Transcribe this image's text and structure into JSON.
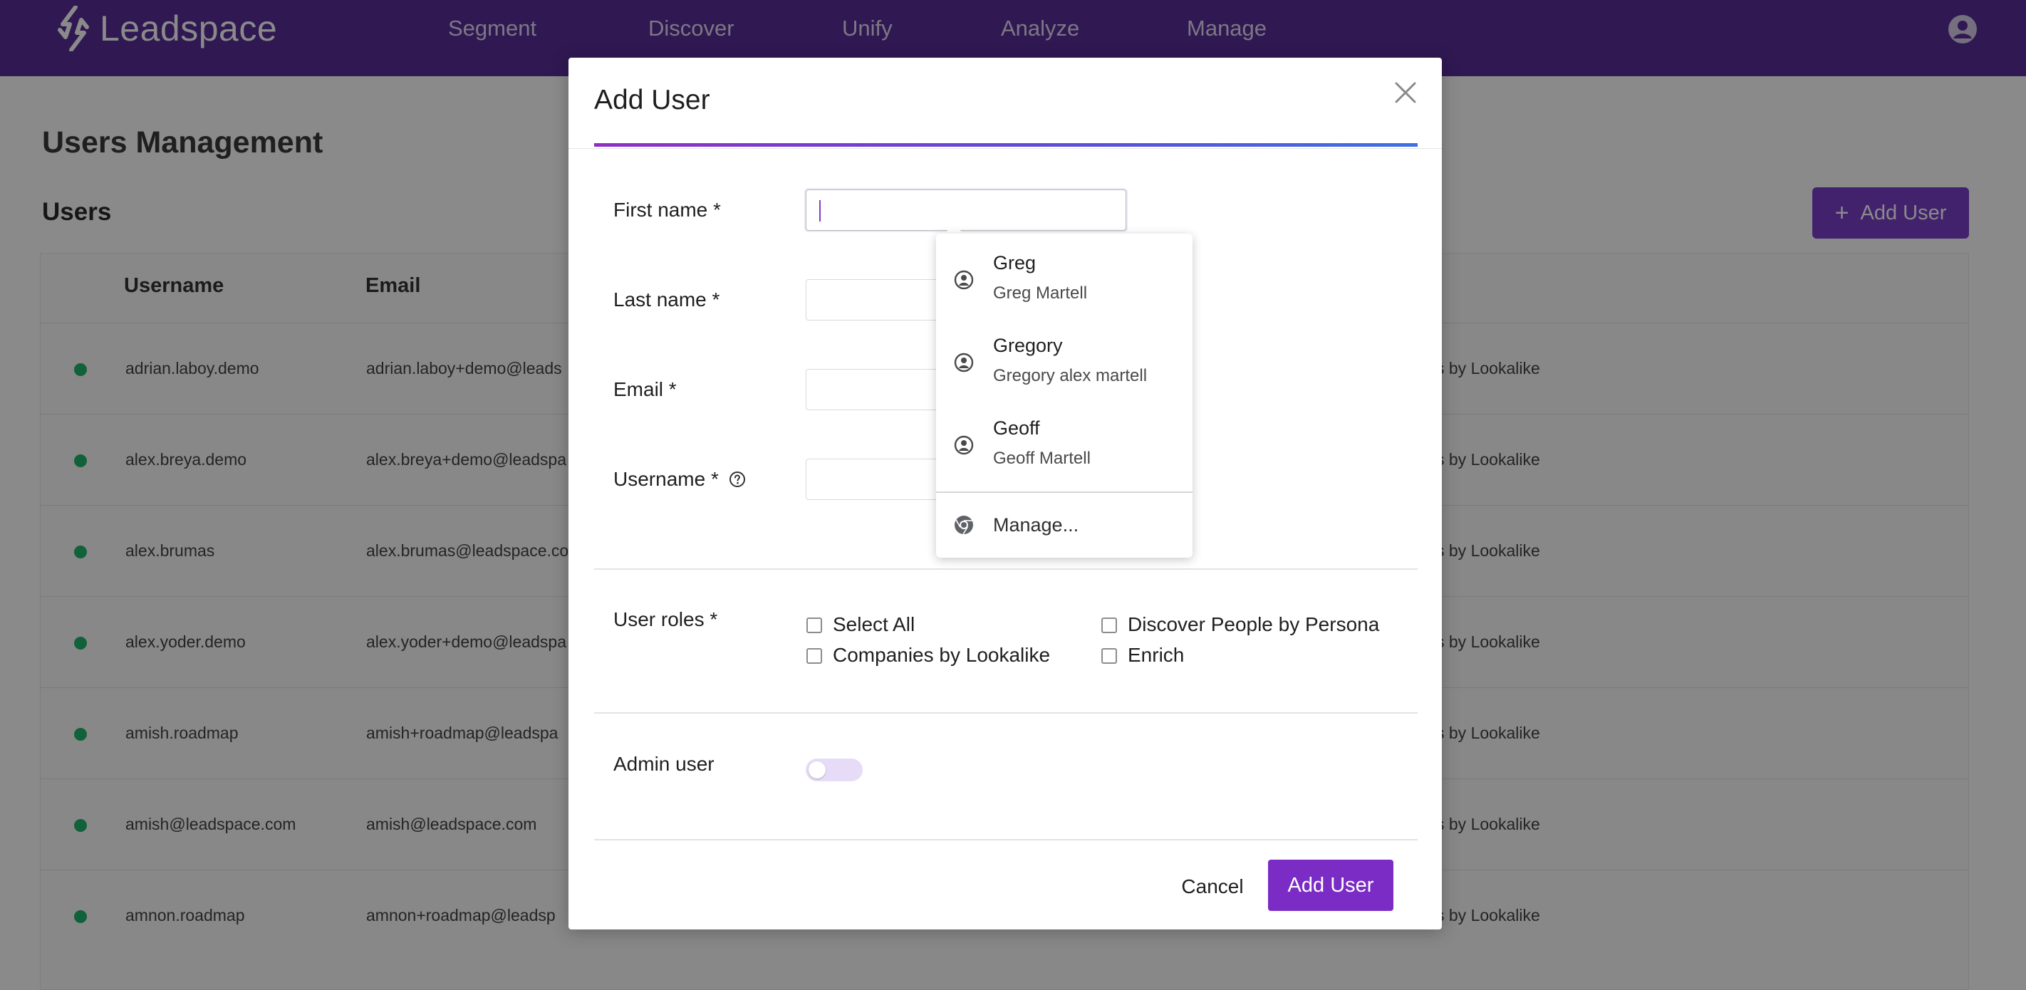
{
  "brand": {
    "name": "Leadspace"
  },
  "nav": [
    "Segment",
    "Discover",
    "Unify",
    "Analyze",
    "Manage"
  ],
  "page": {
    "title": "Users Management",
    "section": "Users",
    "add_button": "Add User",
    "columns": [
      "Username",
      "Email"
    ],
    "rows": [
      {
        "username": "adrian.laboy.demo",
        "email": "adrian.laboy+demo@leads",
        "roles": "s by Lookalike"
      },
      {
        "username": "alex.breya.demo",
        "email": "alex.breya+demo@leadspa",
        "roles": "s by Lookalike"
      },
      {
        "username": "alex.brumas",
        "email": "alex.brumas@leadspace.co",
        "roles": "s by Lookalike"
      },
      {
        "username": "alex.yoder.demo",
        "email": "alex.yoder+demo@leadspa",
        "roles": "s by Lookalike"
      },
      {
        "username": "amish.roadmap",
        "email": "amish+roadmap@leadspa",
        "roles": "s by Lookalike"
      },
      {
        "username": "amish@leadspace.com",
        "email": "amish@leadspace.com",
        "roles": "s by Lookalike"
      },
      {
        "username": "amnon.roadmap",
        "email": "amnon+roadmap@leadsp",
        "roles": "s by Lookalike"
      }
    ]
  },
  "modal": {
    "title": "Add User",
    "fields": {
      "first_name": {
        "label": "First name *",
        "value": ""
      },
      "last_name": {
        "label": "Last name *",
        "value": ""
      },
      "email": {
        "label": "Email *",
        "value": ""
      },
      "username": {
        "label": "Username *",
        "value": ""
      }
    },
    "roles_label": "User roles *",
    "roles": [
      "Select All",
      "Discover People by Persona",
      "Companies by Lookalike",
      "Enrich"
    ],
    "admin_label": "Admin user",
    "admin_on": false,
    "cancel": "Cancel",
    "submit": "Add User"
  },
  "autofill": {
    "suggestions": [
      {
        "name": "Greg",
        "full": "Greg Martell"
      },
      {
        "name": "Gregory",
        "full": "Gregory alex martell"
      },
      {
        "name": "Geoff",
        "full": "Geoff Martell"
      }
    ],
    "manage": "Manage..."
  },
  "colors": {
    "nav_bg": "#5a2d98",
    "accent": "#7a2cc4",
    "status_dot": "#21b36b"
  },
  "icons": [
    "leadspace-logo-icon",
    "account-circle-icon",
    "close-icon",
    "help-circle-icon",
    "person-circle-icon",
    "chrome-icon",
    "plus-icon"
  ]
}
